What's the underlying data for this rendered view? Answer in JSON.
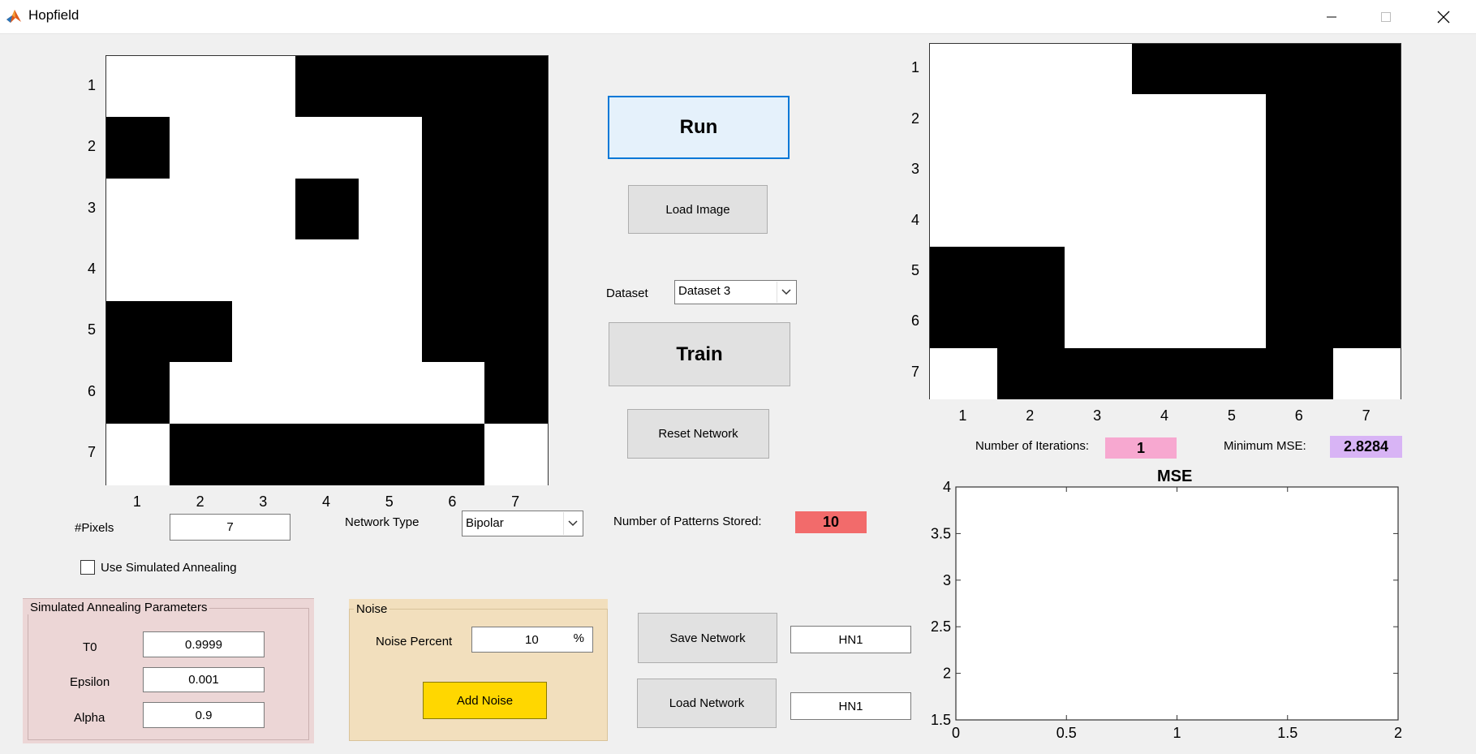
{
  "window": {
    "title": "Hopfield",
    "logo_icon": "matlab-logo-icon",
    "controls": [
      "minimize-icon",
      "maximize-icon",
      "close-icon"
    ]
  },
  "input_grid": {
    "rows": [
      [
        1,
        1,
        1,
        0,
        0,
        0,
        0
      ],
      [
        0,
        1,
        1,
        1,
        1,
        0,
        0
      ],
      [
        1,
        1,
        1,
        0,
        1,
        0,
        0
      ],
      [
        1,
        1,
        1,
        1,
        1,
        0,
        0
      ],
      [
        0,
        0,
        1,
        1,
        1,
        0,
        0
      ],
      [
        0,
        1,
        1,
        1,
        1,
        1,
        0
      ],
      [
        1,
        0,
        0,
        0,
        0,
        0,
        1
      ]
    ],
    "y_ticks": [
      "1",
      "2",
      "3",
      "4",
      "5",
      "6",
      "7"
    ],
    "x_ticks": [
      "1",
      "2",
      "3",
      "4",
      "5",
      "6",
      "7"
    ]
  },
  "output_grid": {
    "rows": [
      [
        1,
        1,
        1,
        0,
        0,
        0,
        0
      ],
      [
        1,
        1,
        1,
        1,
        1,
        0,
        0
      ],
      [
        1,
        1,
        1,
        1,
        1,
        0,
        0
      ],
      [
        1,
        1,
        1,
        1,
        1,
        0,
        0
      ],
      [
        0,
        0,
        1,
        1,
        1,
        0,
        0
      ],
      [
        0,
        0,
        1,
        1,
        1,
        0,
        0
      ],
      [
        1,
        0,
        0,
        0,
        0,
        0,
        1
      ]
    ],
    "y_ticks": [
      "1",
      "2",
      "3",
      "4",
      "5",
      "6",
      "7"
    ],
    "x_ticks": [
      "1",
      "2",
      "3",
      "4",
      "5",
      "6",
      "7"
    ]
  },
  "controls": {
    "run_label": "Run",
    "load_image_label": "Load Image",
    "dataset_label": "Dataset",
    "dataset_value": "Dataset 3",
    "train_label": "Train",
    "reset_label": "Reset Network",
    "pixels_label": "#Pixels",
    "pixels_value": "7",
    "network_type_label": "Network Type",
    "network_type_value": "Bipolar",
    "patterns_label": "Number of Patterns Stored:",
    "patterns_value": "10",
    "use_sa_label": "Use Simulated Annealing",
    "use_sa_checked": false,
    "save_network_label": "Save Network",
    "save_network_value": "HN1",
    "load_network_label": "Load Network",
    "load_network_value": "HN1"
  },
  "sa_panel": {
    "title": "Simulated Annealing Parameters",
    "t0_label": "T0",
    "t0_value": "0.9999",
    "epsilon_label": "Epsilon",
    "epsilon_value": "0.001",
    "alpha_label": "Alpha",
    "alpha_value": "0.9"
  },
  "noise_panel": {
    "title": "Noise",
    "percent_label": "Noise Percent",
    "percent_value": "10",
    "percent_unit": "%",
    "add_noise_label": "Add Noise"
  },
  "stats": {
    "iterations_label": "Number of Iterations:",
    "iterations_value": "1",
    "min_mse_label": "Minimum MSE:",
    "min_mse_value": "2.8284"
  },
  "colors": {
    "patterns_badge": "#f26b6b",
    "iterations_badge": "#f7a8d0",
    "mse_badge": "#d8b4f5",
    "add_noise_button": "#ffd700",
    "sa_panel_bg": "#ecd6d6",
    "noise_panel_bg": "#f2dfbd"
  },
  "chart_data": {
    "type": "line",
    "title": "MSE",
    "xlabel": "",
    "ylabel": "",
    "xlim": [
      0,
      2
    ],
    "ylim": [
      1.5,
      4
    ],
    "x_ticks": [
      "0",
      "0.5",
      "1",
      "1.5",
      "2"
    ],
    "y_ticks": [
      "1.5",
      "2",
      "2.5",
      "3",
      "3.5",
      "4"
    ],
    "series": [],
    "grid": false
  }
}
